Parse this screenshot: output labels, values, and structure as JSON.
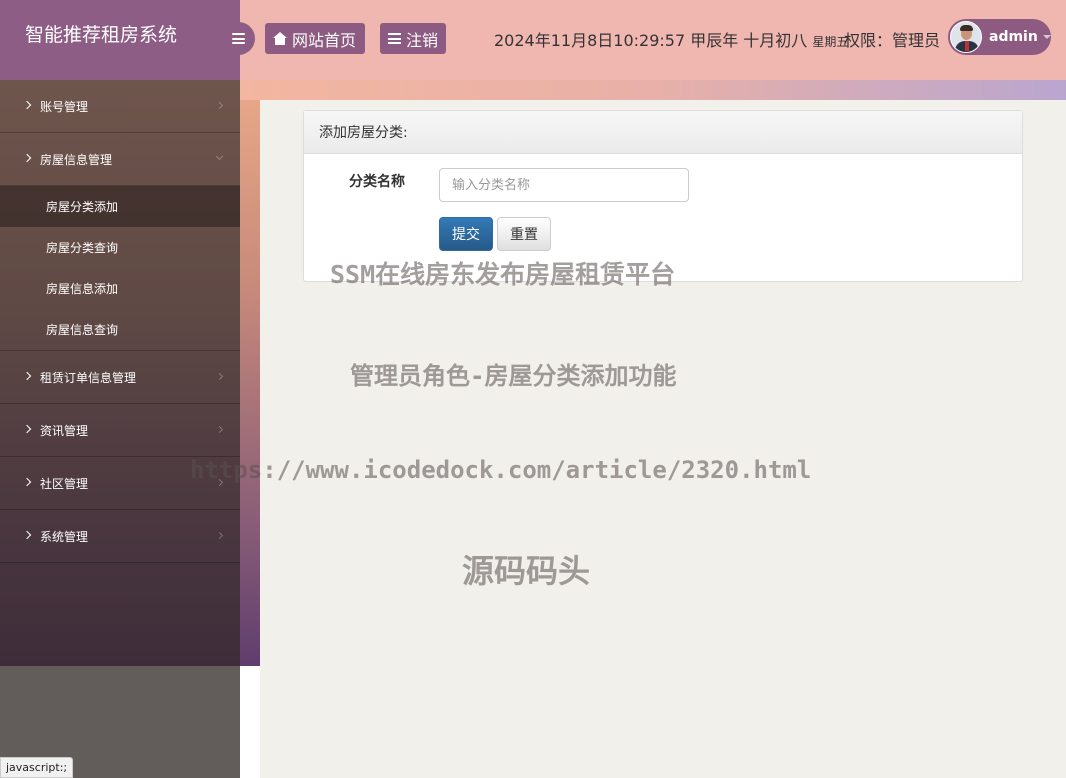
{
  "app": {
    "title": "智能推荐租房系统"
  },
  "header": {
    "home_label": "网站首页",
    "logout_label": "注销",
    "datetime": "2024年11月8日10:29:57 甲辰年 十月初八",
    "weekday": "星期五",
    "permission": "权限：管理员",
    "username": "admin"
  },
  "sidebar": {
    "items": [
      {
        "label": "账号管理"
      },
      {
        "label": "房屋信息管理"
      },
      {
        "label": "租赁订单信息管理"
      },
      {
        "label": "资讯管理"
      },
      {
        "label": "社区管理"
      },
      {
        "label": "系统管理"
      }
    ],
    "submenu": [
      {
        "label": "房屋分类添加"
      },
      {
        "label": "房屋分类查询"
      },
      {
        "label": "房屋信息添加"
      },
      {
        "label": "房屋信息查询"
      }
    ]
  },
  "panel": {
    "title": "添加房屋分类:",
    "field_label": "分类名称",
    "field_placeholder": "输入分类名称",
    "field_value": "",
    "submit_label": "提交",
    "reset_label": "重置"
  },
  "watermark": {
    "line1": "SSM在线房东发布房屋租赁平台",
    "line2": "管理员角色-房屋分类添加功能",
    "line3": "https://www.icodedock.com/article/2320.html",
    "line4": "源码码头"
  },
  "statusbar": {
    "text": "javascript:;"
  },
  "colors": {
    "brand": "#8e5d86",
    "header": "#f0b7b0",
    "primary": "#337ab7"
  },
  "icons": [
    "menu-toggle-icon",
    "home-icon",
    "list-icon",
    "chevron-right-icon",
    "chevron-down-icon",
    "caret-down-icon"
  ]
}
